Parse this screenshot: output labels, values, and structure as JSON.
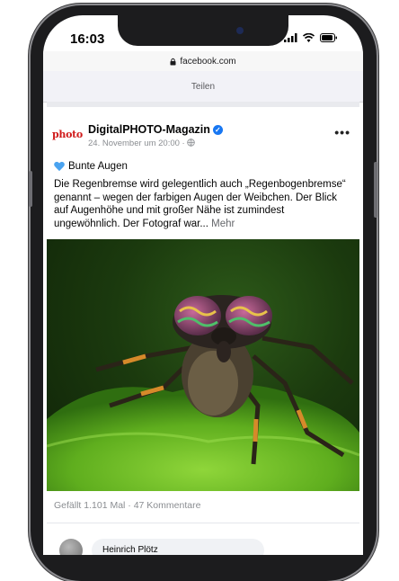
{
  "status_bar": {
    "time": "16:03"
  },
  "browser": {
    "url": "facebook.com",
    "share_label": "Teilen"
  },
  "post": {
    "page_logo_text": "photo",
    "page_name": "DigitalPHOTO-Magazin",
    "date": "24. November um 20:00 · ",
    "more_label": "•••",
    "headline": "Bunte Augen",
    "body_text": "Die Regenbremse wird gelegentlich auch „Regenbogenbremse“ genannt – wegen der farbigen Augen der Weibchen. Der Blick auf Augenhöhe und mit großer Nähe ist zumindest ungewöhnlich. Der Fotograf war... ",
    "more_link": "Mehr",
    "stats": "Gefällt 1.101 Mal · 47 Kommentare"
  },
  "comment": {
    "author": "Heinrich Plötz"
  },
  "colors": {
    "accent": "#1877f2",
    "logo_red": "#d01a1a"
  },
  "icons": [
    "lock-icon",
    "signal-icon",
    "wifi-icon",
    "battery-icon",
    "verified-icon",
    "globe-icon",
    "blue-heart-icon"
  ]
}
